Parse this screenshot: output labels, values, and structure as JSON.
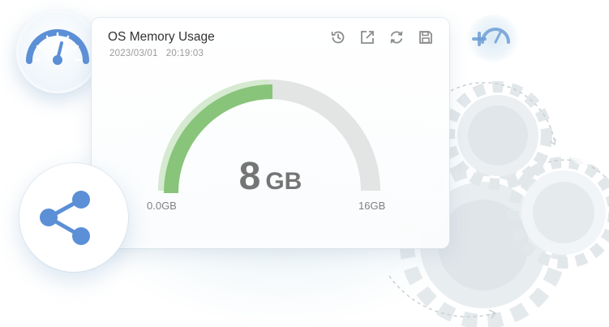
{
  "widget": {
    "title": "OS Memory Usage",
    "date": "2023/03/01",
    "time": "20:19:03",
    "value": "8",
    "unit": "GB",
    "min_label": "0.0GB",
    "max_label": "16GB",
    "used_fraction": 0.5
  },
  "toolbar": {
    "icons": [
      "history-icon",
      "external-link-icon",
      "refresh-icon",
      "save-icon"
    ]
  },
  "colors": {
    "gauge_fill": "#88c47a",
    "gauge_highlight": "#d5ead0",
    "gauge_track": "#e3e4e4",
    "accent_blue": "#5b8fd6",
    "icon_gray": "#8c8c8c",
    "gear_gray": "#dfe5e8"
  }
}
